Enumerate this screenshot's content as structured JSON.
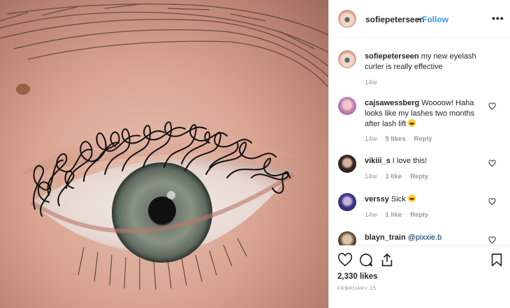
{
  "post": {
    "username": "sofiepeterseen",
    "separator": "•",
    "follow_label": "Follow",
    "more_label": "•••",
    "caption": {
      "username": "sofiepeterseen",
      "text": "my new eyelash curler is really effective",
      "time": "14w"
    },
    "comments": [
      {
        "username": "cajsawessberg",
        "text": "Woooow! Haha looks like my lashes two months after lash lift",
        "emoji": "laughing-emoji",
        "time": "14w",
        "likes": "5 likes",
        "reply": "Reply"
      },
      {
        "username": "vikiii_s",
        "text": "I love this!",
        "time": "14w",
        "likes": "1 like",
        "reply": "Reply"
      },
      {
        "username": "verssy",
        "text": "Sick",
        "emoji": "laughing-emoji",
        "time": "14w",
        "likes": "1 like",
        "reply": "Reply"
      },
      {
        "username": "blayn_train",
        "text": "@pixxie.b"
      }
    ],
    "likes": "2,330 likes",
    "date": "FEBRUARY 15"
  },
  "icons": {
    "heart": "heart-icon",
    "comment": "comment-icon",
    "share": "share-icon",
    "save": "bookmark-icon",
    "more": "more-options-icon"
  },
  "colors": {
    "follow": "#3897f0",
    "muted": "#999999",
    "text": "#262626",
    "divider": "#efefef"
  }
}
